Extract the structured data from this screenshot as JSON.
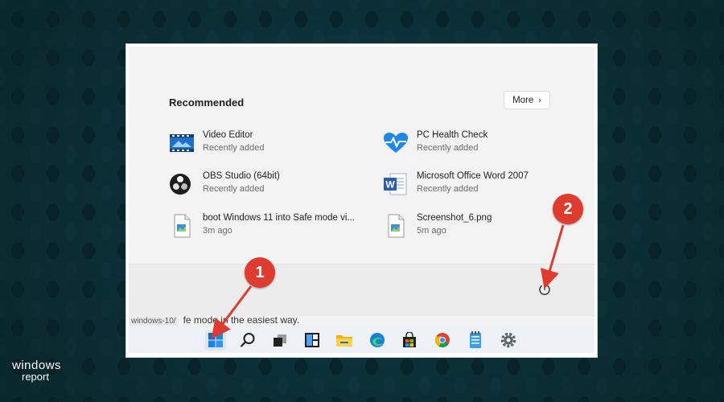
{
  "recommended": {
    "title": "Recommended",
    "more_label": "More",
    "items": [
      {
        "name": "Video Editor",
        "sub": "Recently added",
        "icon": "video-editor-icon"
      },
      {
        "name": "PC Health Check",
        "sub": "Recently added",
        "icon": "pc-health-check-icon"
      },
      {
        "name": "OBS Studio (64bit)",
        "sub": "Recently added",
        "icon": "obs-studio-icon"
      },
      {
        "name": "Microsoft Office Word 2007",
        "sub": "Recently added",
        "icon": "word-icon"
      },
      {
        "name": "boot Windows 11 into Safe mode vi...",
        "sub": "3m ago",
        "icon": "file-icon"
      },
      {
        "name": "Screenshot_6.png",
        "sub": "5m ago",
        "icon": "image-file-icon"
      }
    ]
  },
  "behind_window": {
    "url_fragment": "windows-10/",
    "text": "fe mode in the easiest way."
  },
  "callouts": {
    "one": "1",
    "two": "2"
  },
  "taskbar_icons": [
    "start-icon",
    "search-icon",
    "task-view-icon",
    "widgets-icon",
    "file-explorer-icon",
    "edge-icon",
    "store-icon",
    "chrome-icon",
    "notepad-icon",
    "settings-icon"
  ],
  "logo": {
    "line1": "windows",
    "line2": "report"
  },
  "colors": {
    "callout": "#e03b2f",
    "accent": "#0078d4",
    "background": "#0e3a41"
  }
}
